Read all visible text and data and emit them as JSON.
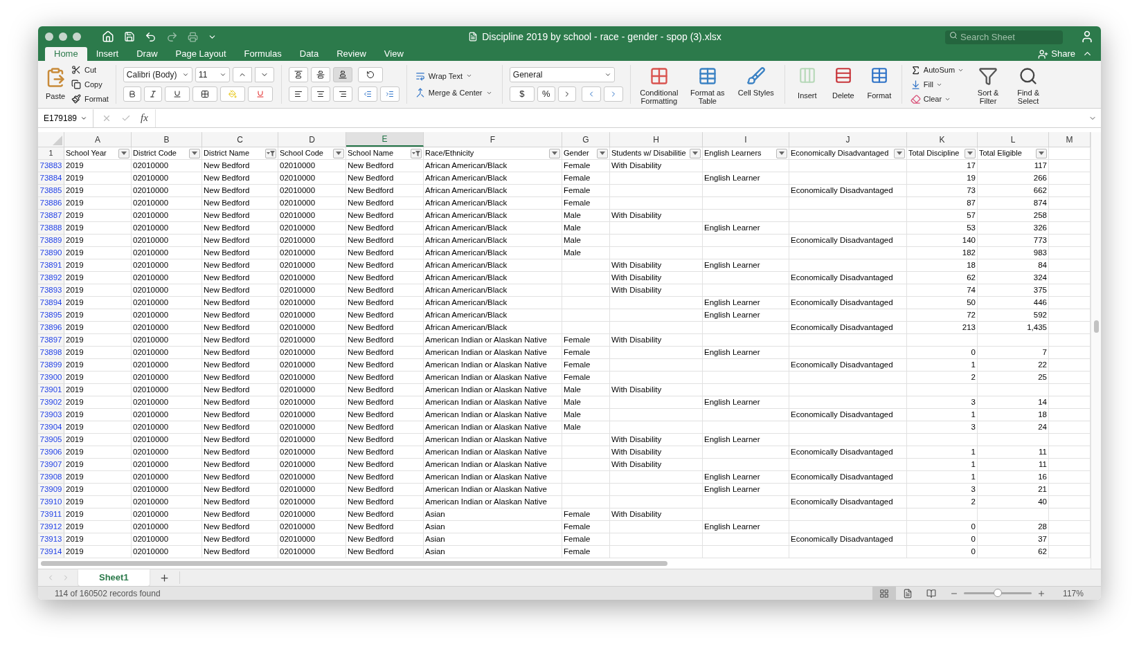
{
  "window": {
    "title": "Discipline 2019 by school - race - gender - spop (3).xlsx",
    "search": {
      "placeholder": "Search Sheet"
    }
  },
  "menu_tabs": [
    {
      "label": "Home",
      "selected": true
    },
    {
      "label": "Insert",
      "selected": false
    },
    {
      "label": "Draw",
      "selected": false
    },
    {
      "label": "Page Layout",
      "selected": false
    },
    {
      "label": "Formulas",
      "selected": false
    },
    {
      "label": "Data",
      "selected": false
    },
    {
      "label": "Review",
      "selected": false
    },
    {
      "label": "View",
      "selected": false
    }
  ],
  "share": {
    "label": "Share"
  },
  "ribbon": {
    "clipboard": {
      "paste": "Paste",
      "items": [
        "Cut",
        "Copy",
        "Format"
      ]
    },
    "font": {
      "name": "Calibri (Body)",
      "size": "11"
    },
    "alignment": {
      "wrap": "Wrap Text",
      "merge": "Merge & Center"
    },
    "number": {
      "format": "General",
      "currency": "$",
      "percent": "%"
    },
    "styles": [
      "Conditional Formatting",
      "Format as Table",
      "Cell Styles"
    ],
    "cells": [
      {
        "label": "Insert",
        "disabled": true
      },
      {
        "label": "Delete",
        "disabled": false
      },
      {
        "label": "Format",
        "disabled": false
      }
    ],
    "editing": {
      "small": [
        "AutoSum",
        "Fill",
        "Clear"
      ],
      "large": [
        "Sort & Filter",
        "Find & Select"
      ]
    }
  },
  "formula_bar": {
    "name_box": "E179189",
    "fx": "fx"
  },
  "sheet": {
    "column_letters": [
      {
        "label": "A",
        "selected": false
      },
      {
        "label": "B",
        "selected": false
      },
      {
        "label": "C",
        "selected": false
      },
      {
        "label": "D",
        "selected": false
      },
      {
        "label": "E",
        "selected": true
      },
      {
        "label": "F",
        "selected": false
      },
      {
        "label": "G",
        "selected": false
      },
      {
        "label": "H",
        "selected": false
      },
      {
        "label": "I",
        "selected": false
      },
      {
        "label": "J",
        "selected": false
      },
      {
        "label": "K",
        "selected": false
      },
      {
        "label": "L",
        "selected": false
      },
      {
        "label": "M",
        "selected": false
      }
    ],
    "header_row": {
      "number": "1",
      "cells": [
        {
          "label": "School Year",
          "filtered": false
        },
        {
          "label": "District Code",
          "filtered": false
        },
        {
          "label": "District Name",
          "filtered": true
        },
        {
          "label": "School Code",
          "filtered": false
        },
        {
          "label": "School Name",
          "filtered": true
        },
        {
          "label": "Race/Ethnicity",
          "filtered": false
        },
        {
          "label": "Gender",
          "filtered": false
        },
        {
          "label": "Students w/ Disabilitie",
          "filtered": false
        },
        {
          "label": "English Learners",
          "filtered": false
        },
        {
          "label": "Economically Disadvantaged",
          "filtered": false
        },
        {
          "label": "Total Discipline",
          "filtered": false
        },
        {
          "label": "Total Eligible",
          "filtered": false
        }
      ]
    },
    "rows": [
      {
        "number": "73883",
        "cells": [
          "2019",
          "02010000",
          "New Bedford",
          "02010000",
          "New Bedford",
          "African American/Black",
          "Female",
          "With Disability",
          null,
          null,
          "17",
          "117"
        ]
      },
      {
        "number": "73884",
        "cells": [
          "2019",
          "02010000",
          "New Bedford",
          "02010000",
          "New Bedford",
          "African American/Black",
          "Female",
          null,
          "English Learner",
          null,
          "19",
          "266"
        ]
      },
      {
        "number": "73885",
        "cells": [
          "2019",
          "02010000",
          "New Bedford",
          "02010000",
          "New Bedford",
          "African American/Black",
          "Female",
          null,
          null,
          "Economically Disadvantaged",
          "73",
          "662"
        ]
      },
      {
        "number": "73886",
        "cells": [
          "2019",
          "02010000",
          "New Bedford",
          "02010000",
          "New Bedford",
          "African American/Black",
          "Female",
          null,
          null,
          null,
          "87",
          "874"
        ]
      },
      {
        "number": "73887",
        "cells": [
          "2019",
          "02010000",
          "New Bedford",
          "02010000",
          "New Bedford",
          "African American/Black",
          "Male",
          "With Disability",
          null,
          null,
          "57",
          "258"
        ]
      },
      {
        "number": "73888",
        "cells": [
          "2019",
          "02010000",
          "New Bedford",
          "02010000",
          "New Bedford",
          "African American/Black",
          "Male",
          null,
          "English Learner",
          null,
          "53",
          "326"
        ]
      },
      {
        "number": "73889",
        "cells": [
          "2019",
          "02010000",
          "New Bedford",
          "02010000",
          "New Bedford",
          "African American/Black",
          "Male",
          null,
          null,
          "Economically Disadvantaged",
          "140",
          "773"
        ]
      },
      {
        "number": "73890",
        "cells": [
          "2019",
          "02010000",
          "New Bedford",
          "02010000",
          "New Bedford",
          "African American/Black",
          "Male",
          null,
          null,
          null,
          "182",
          "983"
        ]
      },
      {
        "number": "73891",
        "cells": [
          "2019",
          "02010000",
          "New Bedford",
          "02010000",
          "New Bedford",
          "African American/Black",
          null,
          "With Disability",
          "English Learner",
          null,
          "18",
          "84"
        ]
      },
      {
        "number": "73892",
        "cells": [
          "2019",
          "02010000",
          "New Bedford",
          "02010000",
          "New Bedford",
          "African American/Black",
          null,
          "With Disability",
          null,
          "Economically Disadvantaged",
          "62",
          "324"
        ]
      },
      {
        "number": "73893",
        "cells": [
          "2019",
          "02010000",
          "New Bedford",
          "02010000",
          "New Bedford",
          "African American/Black",
          null,
          "With Disability",
          null,
          null,
          "74",
          "375"
        ]
      },
      {
        "number": "73894",
        "cells": [
          "2019",
          "02010000",
          "New Bedford",
          "02010000",
          "New Bedford",
          "African American/Black",
          null,
          null,
          "English Learner",
          "Economically Disadvantaged",
          "50",
          "446"
        ]
      },
      {
        "number": "73895",
        "cells": [
          "2019",
          "02010000",
          "New Bedford",
          "02010000",
          "New Bedford",
          "African American/Black",
          null,
          null,
          "English Learner",
          null,
          "72",
          "592"
        ]
      },
      {
        "number": "73896",
        "cells": [
          "2019",
          "02010000",
          "New Bedford",
          "02010000",
          "New Bedford",
          "African American/Black",
          null,
          null,
          null,
          "Economically Disadvantaged",
          "213",
          "1,435"
        ]
      },
      {
        "number": "73897",
        "cells": [
          "2019",
          "02010000",
          "New Bedford",
          "02010000",
          "New Bedford",
          "American Indian or Alaskan Native",
          "Female",
          "With Disability",
          null,
          null,
          null,
          null
        ]
      },
      {
        "number": "73898",
        "cells": [
          "2019",
          "02010000",
          "New Bedford",
          "02010000",
          "New Bedford",
          "American Indian or Alaskan Native",
          "Female",
          null,
          "English Learner",
          null,
          "0",
          "7"
        ]
      },
      {
        "number": "73899",
        "cells": [
          "2019",
          "02010000",
          "New Bedford",
          "02010000",
          "New Bedford",
          "American Indian or Alaskan Native",
          "Female",
          null,
          null,
          "Economically Disadvantaged",
          "1",
          "22"
        ]
      },
      {
        "number": "73900",
        "cells": [
          "2019",
          "02010000",
          "New Bedford",
          "02010000",
          "New Bedford",
          "American Indian or Alaskan Native",
          "Female",
          null,
          null,
          null,
          "2",
          "25"
        ]
      },
      {
        "number": "73901",
        "cells": [
          "2019",
          "02010000",
          "New Bedford",
          "02010000",
          "New Bedford",
          "American Indian or Alaskan Native",
          "Male",
          "With Disability",
          null,
          null,
          null,
          null
        ]
      },
      {
        "number": "73902",
        "cells": [
          "2019",
          "02010000",
          "New Bedford",
          "02010000",
          "New Bedford",
          "American Indian or Alaskan Native",
          "Male",
          null,
          "English Learner",
          null,
          "3",
          "14"
        ]
      },
      {
        "number": "73903",
        "cells": [
          "2019",
          "02010000",
          "New Bedford",
          "02010000",
          "New Bedford",
          "American Indian or Alaskan Native",
          "Male",
          null,
          null,
          "Economically Disadvantaged",
          "1",
          "18"
        ]
      },
      {
        "number": "73904",
        "cells": [
          "2019",
          "02010000",
          "New Bedford",
          "02010000",
          "New Bedford",
          "American Indian or Alaskan Native",
          "Male",
          null,
          null,
          null,
          "3",
          "24"
        ]
      },
      {
        "number": "73905",
        "cells": [
          "2019",
          "02010000",
          "New Bedford",
          "02010000",
          "New Bedford",
          "American Indian or Alaskan Native",
          null,
          "With Disability",
          "English Learner",
          null,
          null,
          null
        ]
      },
      {
        "number": "73906",
        "cells": [
          "2019",
          "02010000",
          "New Bedford",
          "02010000",
          "New Bedford",
          "American Indian or Alaskan Native",
          null,
          "With Disability",
          null,
          "Economically Disadvantaged",
          "1",
          "11"
        ]
      },
      {
        "number": "73907",
        "cells": [
          "2019",
          "02010000",
          "New Bedford",
          "02010000",
          "New Bedford",
          "American Indian or Alaskan Native",
          null,
          "With Disability",
          null,
          null,
          "1",
          "11"
        ]
      },
      {
        "number": "73908",
        "cells": [
          "2019",
          "02010000",
          "New Bedford",
          "02010000",
          "New Bedford",
          "American Indian or Alaskan Native",
          null,
          null,
          "English Learner",
          "Economically Disadvantaged",
          "1",
          "16"
        ]
      },
      {
        "number": "73909",
        "cells": [
          "2019",
          "02010000",
          "New Bedford",
          "02010000",
          "New Bedford",
          "American Indian or Alaskan Native",
          null,
          null,
          "English Learner",
          null,
          "3",
          "21"
        ]
      },
      {
        "number": "73910",
        "cells": [
          "2019",
          "02010000",
          "New Bedford",
          "02010000",
          "New Bedford",
          "American Indian or Alaskan Native",
          null,
          null,
          null,
          "Economically Disadvantaged",
          "2",
          "40"
        ]
      },
      {
        "number": "73911",
        "cells": [
          "2019",
          "02010000",
          "New Bedford",
          "02010000",
          "New Bedford",
          "Asian",
          "Female",
          "With Disability",
          null,
          null,
          null,
          null
        ]
      },
      {
        "number": "73912",
        "cells": [
          "2019",
          "02010000",
          "New Bedford",
          "02010000",
          "New Bedford",
          "Asian",
          "Female",
          null,
          "English Learner",
          null,
          "0",
          "28"
        ]
      },
      {
        "number": "73913",
        "cells": [
          "2019",
          "02010000",
          "New Bedford",
          "02010000",
          "New Bedford",
          "Asian",
          "Female",
          null,
          null,
          "Economically Disadvantaged",
          "0",
          "37"
        ]
      },
      {
        "number": "73914",
        "cells": [
          "2019",
          "02010000",
          "New Bedford",
          "02010000",
          "New Bedford",
          "Asian",
          "Female",
          null,
          null,
          null,
          "0",
          "62"
        ]
      }
    ]
  },
  "sheet_tabs": [
    {
      "label": "Sheet1",
      "selected": true
    }
  ],
  "status_bar": {
    "text": "114 of 160502 records found",
    "views": [
      {
        "kind": "normal",
        "selected": true
      },
      {
        "kind": "page_layout",
        "selected": false
      },
      {
        "kind": "page_break",
        "selected": false
      }
    ],
    "zoom": {
      "level": 0.5,
      "reading": "117%"
    }
  }
}
